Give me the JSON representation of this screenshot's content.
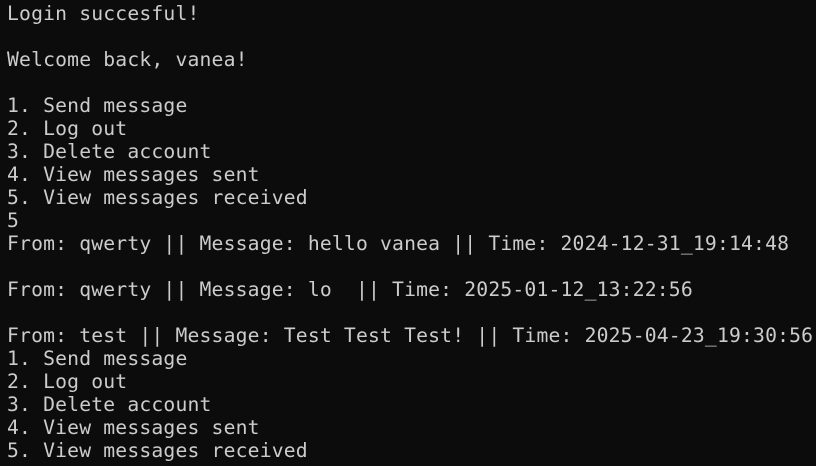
{
  "terminal": {
    "lines": [
      "Login succesful!",
      "",
      "Welcome back, vanea!",
      "",
      "1. Send message",
      "2. Log out",
      "3. Delete account",
      "4. View messages sent",
      "5. View messages received",
      "5",
      "From: qwerty || Message: hello vanea || Time: 2024-12-31_19:14:48",
      "",
      "From: qwerty || Message: lo  || Time: 2025-01-12_13:22:56",
      "",
      "From: test || Message: Test Test Test! || Time: 2025-04-23_19:30:56",
      "1. Send message",
      "2. Log out",
      "3. Delete account",
      "4. View messages sent",
      "5. View messages received"
    ]
  },
  "colors": {
    "background": "#0c0c0c",
    "text": "#cccccc"
  }
}
